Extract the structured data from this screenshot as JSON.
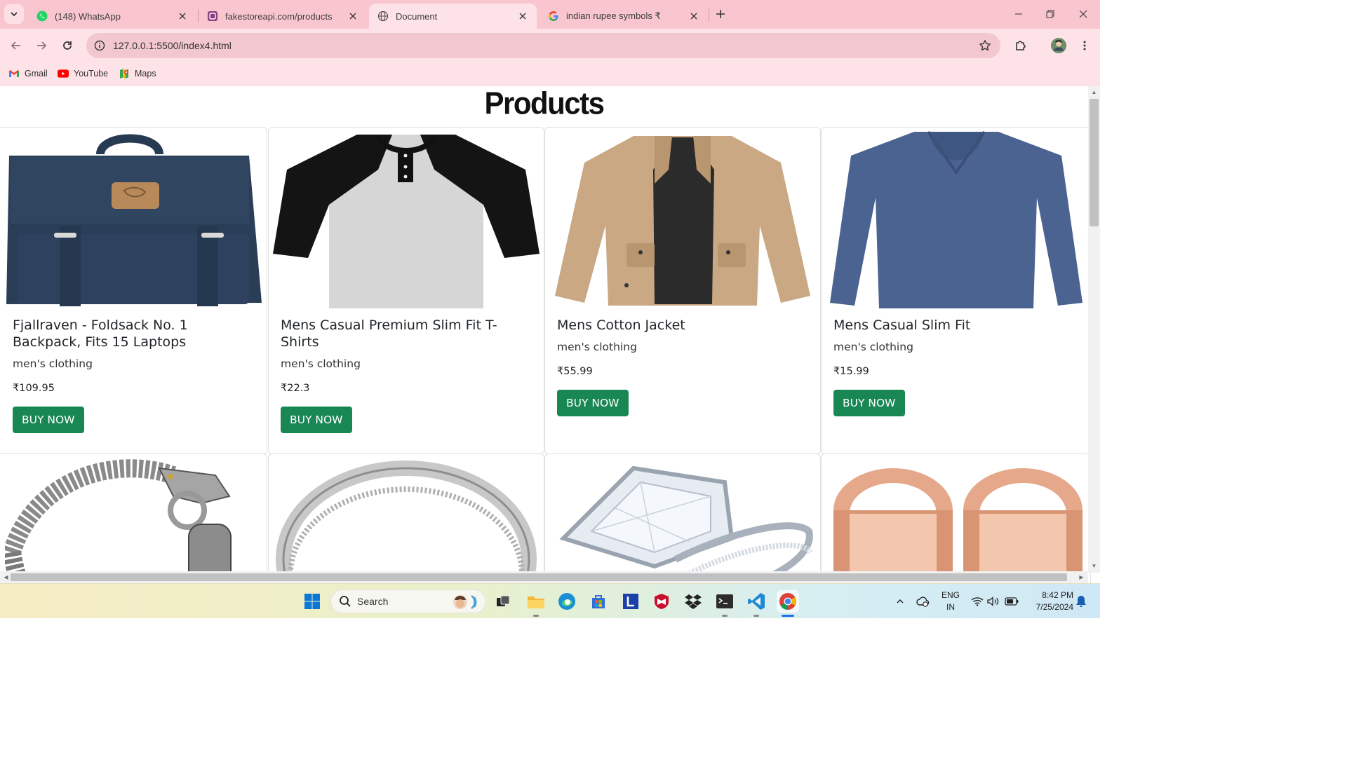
{
  "browser": {
    "tabs": [
      {
        "title": "(148) WhatsApp",
        "icon": "whatsapp-icon",
        "active": false
      },
      {
        "title": "fakestoreapi.com/products",
        "icon": "fakestore-icon",
        "active": false
      },
      {
        "title": "Document",
        "icon": "globe-icon",
        "active": true
      },
      {
        "title": "indian rupee symbols ₹",
        "icon": "google-icon",
        "active": false
      }
    ],
    "url": "127.0.0.1:5500/index4.html",
    "bookmarks": [
      {
        "label": "Gmail",
        "icon": "gmail-icon"
      },
      {
        "label": "YouTube",
        "icon": "youtube-icon"
      },
      {
        "label": "Maps",
        "icon": "maps-icon"
      }
    ],
    "colors": {
      "tabstrip": "#f9c6cf",
      "toolbar": "#fde2e7",
      "omnibox": "#f3c7cf"
    }
  },
  "page": {
    "title": "Products",
    "buy_label": "BUY NOW",
    "button_color": "#198754",
    "products": [
      {
        "title": "Fjallraven - Foldsack No. 1 Backpack, Fits 15 Laptops",
        "category": "men's clothing",
        "price": "₹109.95",
        "image": "backpack-image"
      },
      {
        "title": "Mens Casual Premium Slim Fit T-Shirts",
        "category": "men's clothing",
        "price": "₹22.3",
        "image": "tshirt-image"
      },
      {
        "title": "Mens Cotton Jacket",
        "category": "men's clothing",
        "price": "₹55.99",
        "image": "jacket-image"
      },
      {
        "title": "Mens Casual Slim Fit",
        "category": "men's clothing",
        "price": "₹15.99",
        "image": "longsleeve-image"
      }
    ],
    "row2_images": [
      "chain-bracelet-image",
      "silver-ring-image",
      "diamond-ring-image",
      "rose-gold-plugs-image"
    ]
  },
  "taskbar": {
    "search_placeholder": "Search",
    "language": [
      "ENG",
      "IN"
    ],
    "time": "8:42 PM",
    "date": "7/25/2024"
  }
}
